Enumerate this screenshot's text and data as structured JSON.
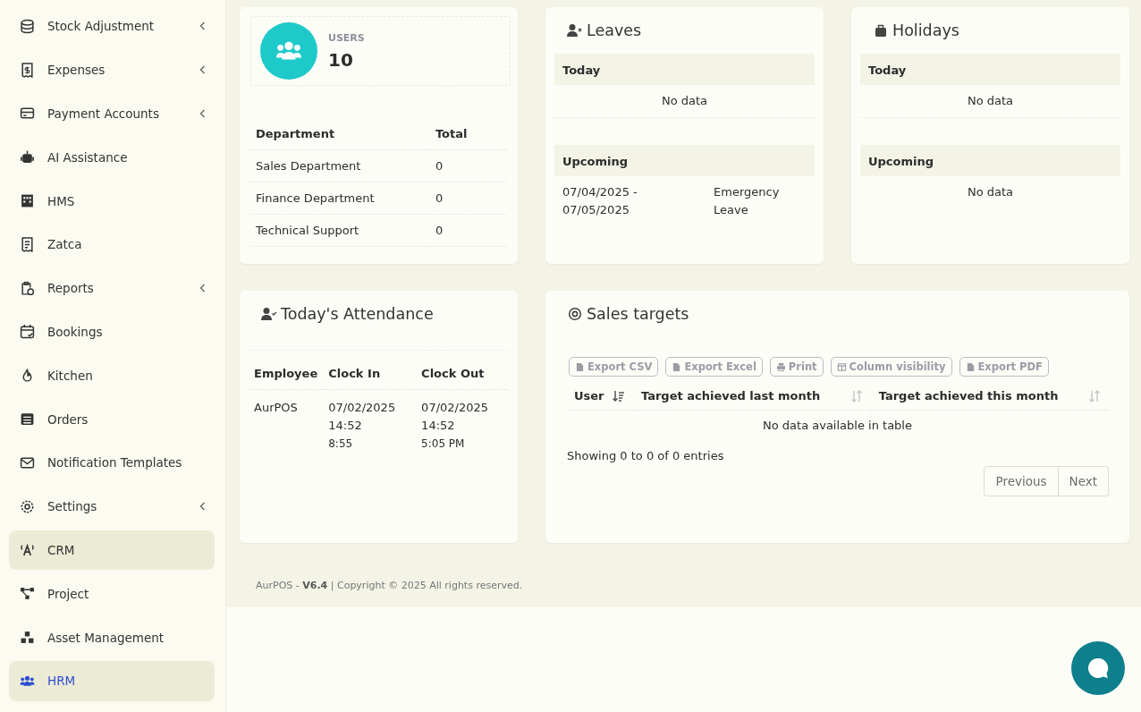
{
  "sidebar": {
    "items": [
      {
        "label": "Stock Adjustment",
        "has_submenu": true,
        "selected": false,
        "open": false
      },
      {
        "label": "Expenses",
        "has_submenu": true,
        "selected": false,
        "open": false
      },
      {
        "label": "Payment Accounts",
        "has_submenu": true,
        "selected": false,
        "open": false
      },
      {
        "label": "AI Assistance",
        "has_submenu": false,
        "selected": false,
        "open": false
      },
      {
        "label": "HMS",
        "has_submenu": false,
        "selected": false,
        "open": false
      },
      {
        "label": "Zatca",
        "has_submenu": false,
        "selected": false,
        "open": false
      },
      {
        "label": "Reports",
        "has_submenu": true,
        "selected": false,
        "open": false
      },
      {
        "label": "Bookings",
        "has_submenu": false,
        "selected": false,
        "open": false
      },
      {
        "label": "Kitchen",
        "has_submenu": false,
        "selected": false,
        "open": false
      },
      {
        "label": "Orders",
        "has_submenu": false,
        "selected": false,
        "open": false
      },
      {
        "label": "Notification Templates",
        "has_submenu": false,
        "selected": false,
        "open": false
      },
      {
        "label": "Settings",
        "has_submenu": true,
        "selected": false,
        "open": false
      },
      {
        "label": "CRM",
        "has_submenu": false,
        "selected": false,
        "open": true
      },
      {
        "label": "Project",
        "has_submenu": false,
        "selected": false,
        "open": false
      },
      {
        "label": "Asset Management",
        "has_submenu": false,
        "selected": false,
        "open": false
      },
      {
        "label": "HRM",
        "has_submenu": false,
        "selected": true,
        "open": true
      }
    ]
  },
  "users_card": {
    "label": "USERS",
    "value": "10",
    "columns": [
      "Department",
      "Total"
    ],
    "rows": [
      [
        "Sales Department",
        "0"
      ],
      [
        "Finance Department",
        "0"
      ],
      [
        "Technical Support",
        "0"
      ]
    ]
  },
  "leaves": {
    "title": "Leaves",
    "today_label": "Today",
    "today_empty": "No data",
    "upcoming_label": "Upcoming",
    "upcoming": [
      {
        "dates": "07/04/2025 - 07/05/2025",
        "type": "Emergency Leave"
      }
    ]
  },
  "holidays": {
    "title": "Holidays",
    "today_label": "Today",
    "today_empty": "No data",
    "upcoming_label": "Upcoming",
    "upcoming_empty": "No data"
  },
  "attendance": {
    "title": "Today's Attendance",
    "columns": [
      "Employee",
      "Clock In",
      "Clock Out"
    ],
    "rows": [
      {
        "employee": "AurPOS",
        "clock_in": "07/02/2025 14:52",
        "clock_in_note": "8:55",
        "clock_out": "07/02/2025 14:52",
        "clock_out_note": "5:05 PM"
      }
    ]
  },
  "sales_targets": {
    "title": "Sales targets",
    "buttons": [
      "Export CSV",
      "Export Excel",
      "Print",
      "Column visibility",
      "Export PDF"
    ],
    "columns": [
      {
        "label": "User",
        "sorted": true
      },
      {
        "label": "Target achieved last month",
        "sorted": false
      },
      {
        "label": "Target achieved this month",
        "sorted": false
      }
    ],
    "empty": "No data available in table",
    "info": "Showing 0 to 0 of 0 entries",
    "pagination": [
      "Previous",
      "Next"
    ]
  },
  "footer": {
    "text": "AurPOS - **V6.4** | Copyright © 2025 All rights reserved."
  }
}
